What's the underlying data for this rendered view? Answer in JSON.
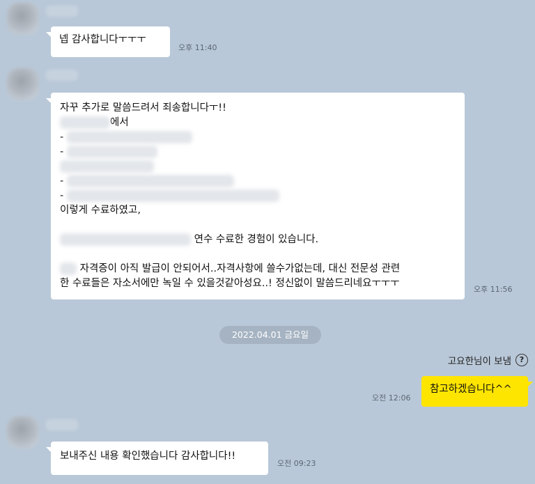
{
  "chat": {
    "messages": [
      {
        "side": "in",
        "lines": [
          "넵 감사합니다ㅜㅜㅜ"
        ],
        "time": "오후 11:40"
      },
      {
        "side": "in",
        "lines": [
          "자꾸 추가로 말씀드려서 죄송합니다ㅜ!!",
          "에서",
          "-",
          "-",
          "-",
          "-",
          "이렇게 수료하였고,",
          "연수 수료한 경험이 있습니다.",
          "자격증이 아직 발급이 안되어서..자격사항에 쓸수가없는데, 대신 전문성 관련",
          "한 수료들은 자소서에만 녹일 수 있을것같아성요..! 정신없이 말씀드리네요ㅜㅜㅜ"
        ],
        "time": "오후 11:56"
      }
    ],
    "date_divider": "2022.04.01 금요일",
    "sender_note": "고요한님이 보냄",
    "help_icon": "question-circle-icon",
    "my_message": {
      "text": "참고하겠습니다^^",
      "time": "오전 12:06"
    },
    "last_message": {
      "text": "보내주신 내용 확인했습니다 감사합니다!!",
      "time": "오전 09:23"
    }
  },
  "colors": {
    "background": "#b9c8d8",
    "incoming_bubble": "#ffffff",
    "outgoing_bubble": "#fee500",
    "date_pill": "#a5b3c2"
  }
}
